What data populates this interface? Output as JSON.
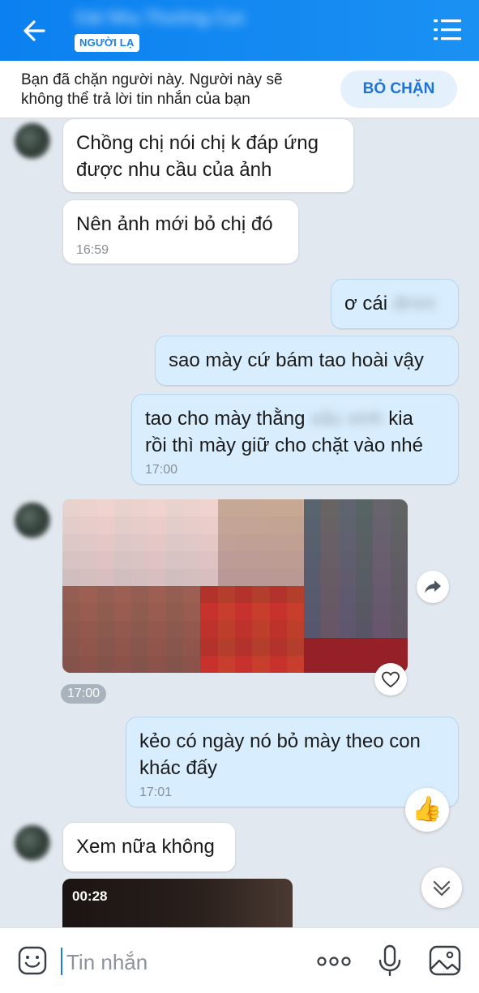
{
  "header": {
    "back_icon": "arrow-left-icon",
    "contact_name": "Gái Nhụ Thường Cục",
    "badge": "NGƯỜI LẠ",
    "menu_icon": "list-menu-icon"
  },
  "block_banner": {
    "text_line1": "Bạn đã chặn người này. Người này sẽ",
    "text_line2": "không thể trả lời tin nhắn của bạn",
    "unblock_label": "BỎ CHẶN"
  },
  "messages": [
    {
      "direction": "in",
      "lines": [
        "Chồng chị nói chị k đáp ứng",
        "được nhu cầu của ảnh"
      ]
    },
    {
      "direction": "in",
      "lines": [
        "Nên ảnh mới bỏ chị đó"
      ],
      "time": "16:59"
    },
    {
      "direction": "out",
      "text": "ơ cái",
      "blurred": "đmm"
    },
    {
      "direction": "out",
      "lines": [
        "sao mày cứ bám tao hoài vậy"
      ]
    },
    {
      "direction": "out",
      "line1_a": "tao cho mày thằng",
      "line1_blurred": "xấu xinh",
      "line1_b": "kia",
      "line2": "rồi thì mày giữ cho chặt vào nhé",
      "time": "17:00"
    },
    {
      "direction": "in",
      "type": "photo",
      "time": "17:00"
    },
    {
      "direction": "out",
      "lines": [
        "kẻo có ngày nó bỏ mày theo con",
        "khác đấy"
      ],
      "time": "17:01",
      "reaction": "👍"
    },
    {
      "direction": "in",
      "lines": [
        "Xem nữa không"
      ]
    },
    {
      "direction": "in",
      "type": "video",
      "duration": "00:28"
    }
  ],
  "input_bar": {
    "placeholder": "Tin nhắn",
    "icons": [
      "emoji-icon",
      "more-dots-icon",
      "microphone-icon",
      "image-icon"
    ]
  },
  "colors": {
    "header_blue": "#1a91f2",
    "chat_background": "#e2e8ef",
    "outgoing_bubble": "#d8eefe",
    "incoming_bubble": "#ffffff",
    "accent_blue": "#1e74d6"
  }
}
